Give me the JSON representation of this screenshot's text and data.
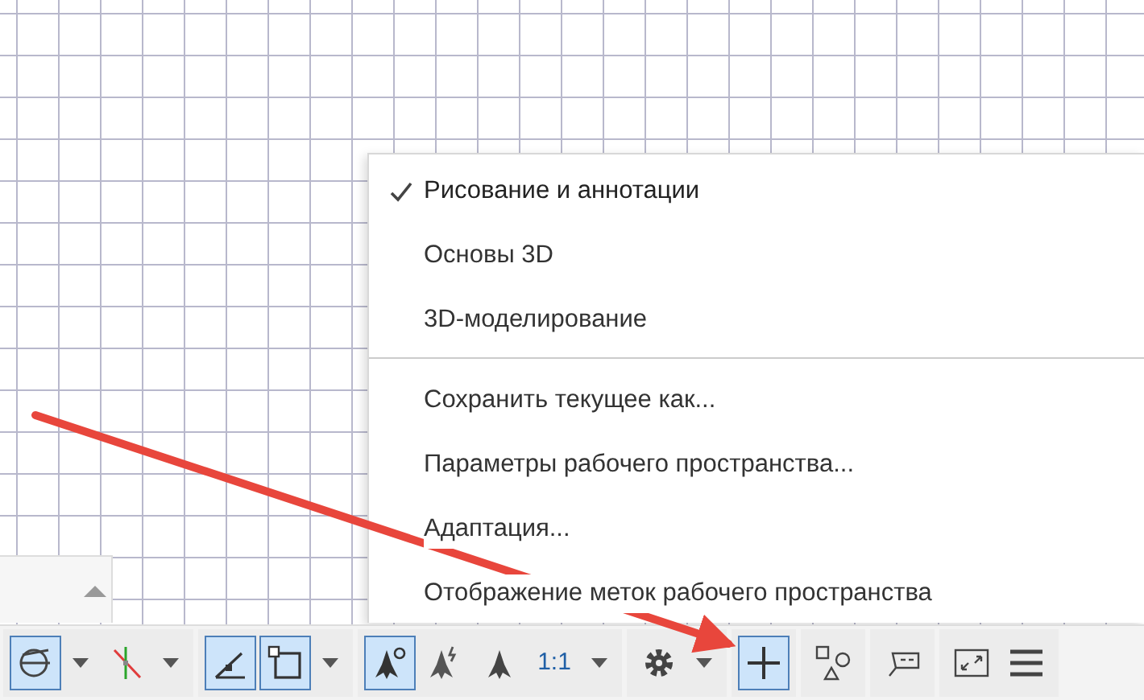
{
  "menu": {
    "items": [
      {
        "label": "Рисование и аннотации",
        "selected": true
      },
      {
        "label": "Основы 3D",
        "selected": false
      },
      {
        "label": "3D-моделирование",
        "selected": false
      },
      {
        "kind": "separator"
      },
      {
        "label": "Сохранить текущее как...",
        "selected": false
      },
      {
        "label": "Параметры рабочего пространства...",
        "selected": false
      },
      {
        "label": "Адаптация...",
        "selected": false
      },
      {
        "label": "Отображение меток рабочего пространства",
        "selected": false
      }
    ]
  },
  "status_bar": {
    "groups": [
      [
        {
          "kind": "icon",
          "on": true,
          "dropdown": true
        },
        {
          "kind": "icon",
          "on": false,
          "dropdown": true
        }
      ],
      [
        {
          "kind": "icon",
          "on": true,
          "dropdown": false
        },
        {
          "kind": "icon",
          "on": true,
          "dropdown": true
        }
      ],
      [
        {
          "kind": "icon",
          "on": true,
          "dropdown": false
        },
        {
          "kind": "icon",
          "on": false,
          "dropdown": false
        },
        {
          "kind": "icon",
          "on": false,
          "dropdown": false
        },
        {
          "kind": "text",
          "label": "1:1",
          "on": false,
          "dropdown": true
        }
      ],
      [
        {
          "kind": "icon",
          "on": false,
          "dropdown": true
        }
      ],
      [
        {
          "kind": "icon",
          "on": true,
          "dropdown": false
        }
      ],
      [
        {
          "kind": "icon",
          "on": false,
          "dropdown": false
        }
      ],
      [
        {
          "kind": "icon",
          "on": false,
          "dropdown": false
        }
      ],
      [
        {
          "kind": "icon",
          "on": false,
          "dropdown": false
        },
        {
          "kind": "icon",
          "on": false,
          "dropdown": false
        }
      ]
    ]
  }
}
